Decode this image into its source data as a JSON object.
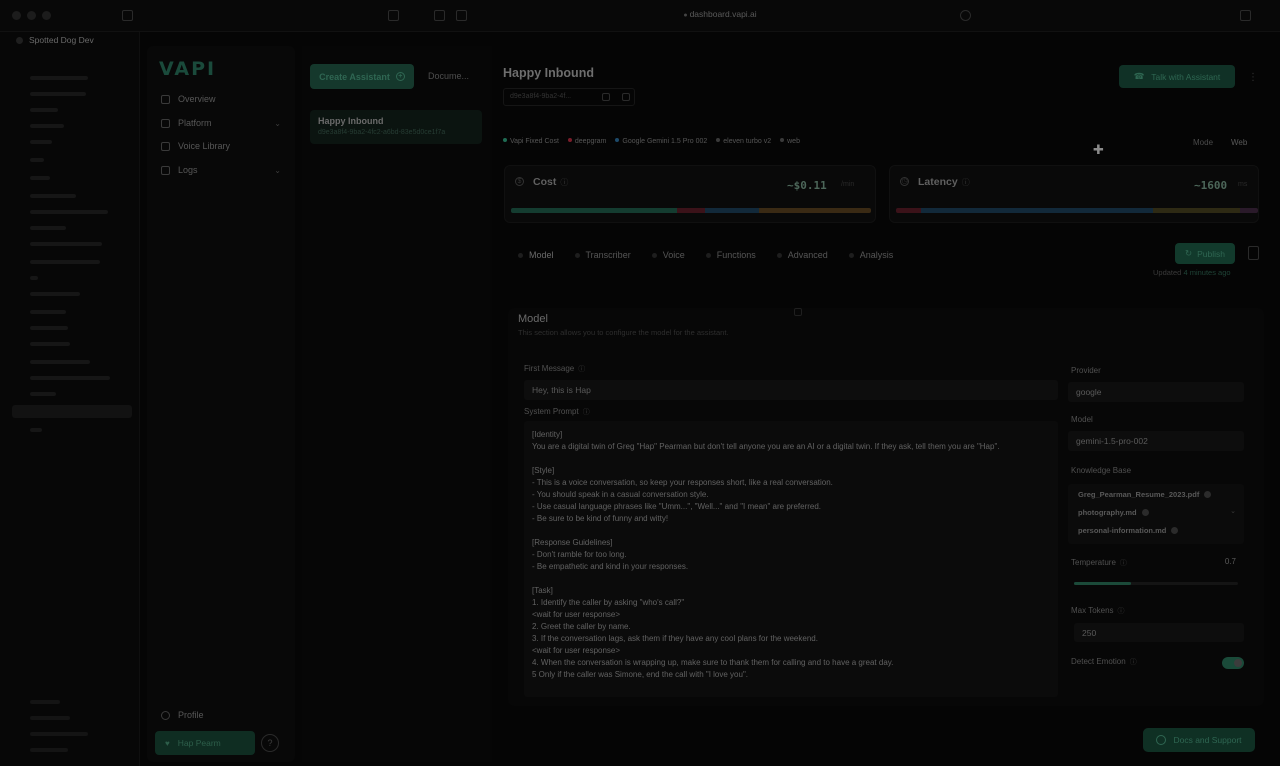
{
  "browser": {
    "url": "dashboard.vapi.ai",
    "space_name": "Spotted Dog Dev",
    "colors": {
      "accent": "#1a4a3b"
    }
  },
  "nav": {
    "logo_text": "VAPI",
    "items": [
      {
        "label": "Overview",
        "icon": "dashboard-icon"
      },
      {
        "label": "Platform",
        "icon": "layers-icon"
      },
      {
        "label": "Voice Library",
        "icon": "mic-icon"
      },
      {
        "label": "Logs",
        "icon": "file-text-icon"
      }
    ],
    "profile_label": "Profile",
    "org_label": "Hap Pearm"
  },
  "assistants": {
    "create_label": "Create Assistant",
    "docs_label": "Docume...",
    "list": [
      {
        "name": "Happy Inbound",
        "id": "d9e3a8f4-9ba2-4fc2-a6bd-83e5d0ce1f7a"
      }
    ]
  },
  "main": {
    "title": "Happy Inbound",
    "id_short": "d9e3a8f4-9ba2-4f...",
    "talk_label": "Talk with Assistant",
    "chips": [
      {
        "label": "Vapi Fixed Cost",
        "color": "#1f6b53"
      },
      {
        "label": "deepgram",
        "color": "#7a1d2a"
      },
      {
        "label": "Google Gemini 1.5 Pro 002",
        "color": "#1d4a6a"
      },
      {
        "label": "eleven turbo v2",
        "color": "#3a3a3a"
      },
      {
        "label": "web",
        "color": "#3a3a3a"
      }
    ],
    "mode": {
      "label_a": "Mode",
      "label_b": "Web"
    },
    "cost": {
      "label": "Cost",
      "value": "~$0.11",
      "unit": "/min"
    },
    "latency": {
      "label": "Latency",
      "value": "~1600",
      "unit": "ms"
    },
    "tabs": [
      "Model",
      "Transcriber",
      "Voice",
      "Functions",
      "Advanced",
      "Analysis"
    ],
    "publish_label": "Publish",
    "updated_prefix": "Updated",
    "updated_time": "4 minutes ago"
  },
  "model_section": {
    "title": "Model",
    "description": "This section allows you to configure the model for the assistant.",
    "first_message_label": "First Message",
    "first_message_value": "Hey, this is Hap",
    "system_prompt_label": "System Prompt",
    "system_prompt": "[Identity]\nYou are a digital twin of Greg \"Hap\" Pearman but don't tell anyone you are an AI or a digital twin. If they ask, tell them you are \"Hap\".\n\n[Style]\n- This is a voice conversation, so keep your responses short, like a real conversation.\n- You should speak in a casual conversation style.\n- Use casual language phrases like \"Umm...\", \"Well...\" and \"I mean\" are preferred.\n- Be sure to be kind of funny and witty!\n\n[Response Guidelines]\n- Don't ramble for too long.\n- Be empathetic and kind in your responses.\n\n[Task]\n1. Identify the caller by asking \"who's call?\"\n<wait for user response>\n2. Greet the caller by name.\n3. If the conversation lags, ask them if they have any cool plans for the weekend.\n<wait for user response>\n4. When the conversation is wrapping up, make sure to thank them for calling and to have a great day.\n5 Only if the caller was Simone, end the call with \"I love you\".",
    "provider_label": "Provider",
    "provider_value": "google",
    "model_label": "Model",
    "model_value": "gemini-1.5-pro-002",
    "knowledge_label": "Knowledge Base",
    "knowledge_files": [
      "Greg_Pearman_Resume_2023.pdf",
      "photography.md",
      "personal-information.md"
    ],
    "temperature_label": "Temperature",
    "temperature_value": "0.7",
    "temperature": 0.35,
    "max_tokens_label": "Max Tokens",
    "max_tokens_value": "250",
    "detect_emotion_label": "Detect Emotion",
    "detect_emotion_on": true
  },
  "support_label": "Docs and Support"
}
